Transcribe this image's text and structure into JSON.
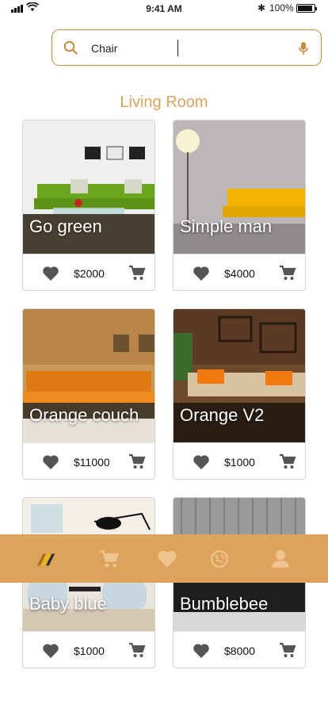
{
  "status_bar": {
    "time": "9:41 AM",
    "battery": "100%",
    "battery_level": 1.0
  },
  "search": {
    "value": "Chair",
    "icon": "search-icon",
    "mic_icon": "mic-icon"
  },
  "section": {
    "title": "Living Room"
  },
  "products": [
    {
      "name": "Go green",
      "price": "$2000"
    },
    {
      "name": "Simple man",
      "price": "$4000"
    },
    {
      "name": "Orange couch",
      "price": "$11000"
    },
    {
      "name": "Orange V2",
      "price": "$1000"
    },
    {
      "name": "Baby blue",
      "price": "$1000"
    },
    {
      "name": "Bumblebee",
      "price": "$8000"
    }
  ],
  "tabs": [
    "logo-icon",
    "cart-icon",
    "heart-icon",
    "explore-icon",
    "profile-icon"
  ],
  "colors": {
    "accent": "#dda35d",
    "search_border": "#c98a3c",
    "title": "#dba35c",
    "icon_grey": "#555555"
  }
}
